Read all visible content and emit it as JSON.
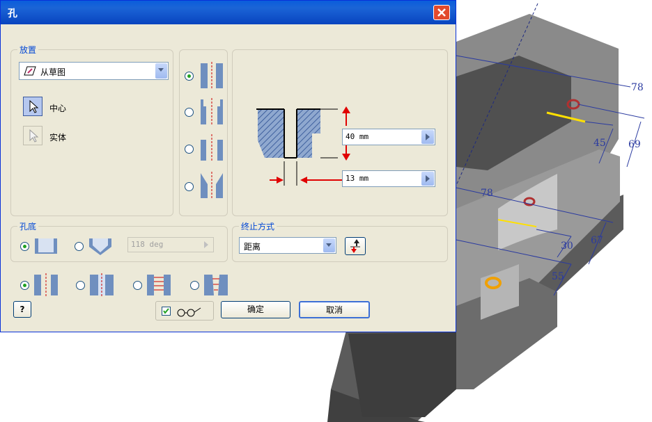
{
  "dialog": {
    "title": "孔",
    "placement": {
      "group_label": "放置",
      "source_value": "从草图",
      "center_label": "中心",
      "solid_label": "实体"
    },
    "hole_types": {
      "selected_index": 0
    },
    "dimensions": {
      "depth_value": "40 mm",
      "diameter_value": "13 mm"
    },
    "drill_point": {
      "group_label": "孔底",
      "angle_value": "118 deg",
      "selected": "flat"
    },
    "termination": {
      "group_label": "终止方式",
      "value": "距离"
    },
    "ok_label": "确定",
    "cancel_label": "取消",
    "preview_checked": true
  },
  "model": {
    "dimension_labels": [
      "78",
      "45",
      "69",
      "78",
      "30",
      "67",
      "55"
    ]
  }
}
